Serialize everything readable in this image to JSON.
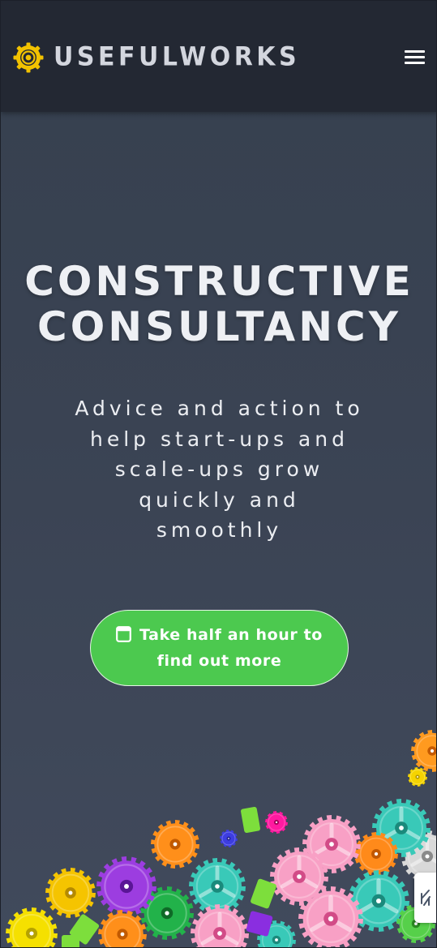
{
  "header": {
    "brand": "USEFULWORKS",
    "logo_icon": "gear-logo-icon",
    "menu_icon": "hamburger-menu-icon"
  },
  "hero": {
    "title": "CONSTRUCTIVE\nCONSULTANCY",
    "subtitle": "Advice and action to help start-ups and scale-ups grow quickly and smoothly",
    "cta_label": "Take half an hour to find out more",
    "cta_icon": "calendar-icon"
  },
  "widget": {
    "icon": "chat-widget-icon"
  },
  "colors": {
    "header_bg": "#232833",
    "page_bg": "#3a4353",
    "brand_yellow": "#f2c200",
    "cta_green": "#4cc94f",
    "text_light": "#eef0f4"
  }
}
